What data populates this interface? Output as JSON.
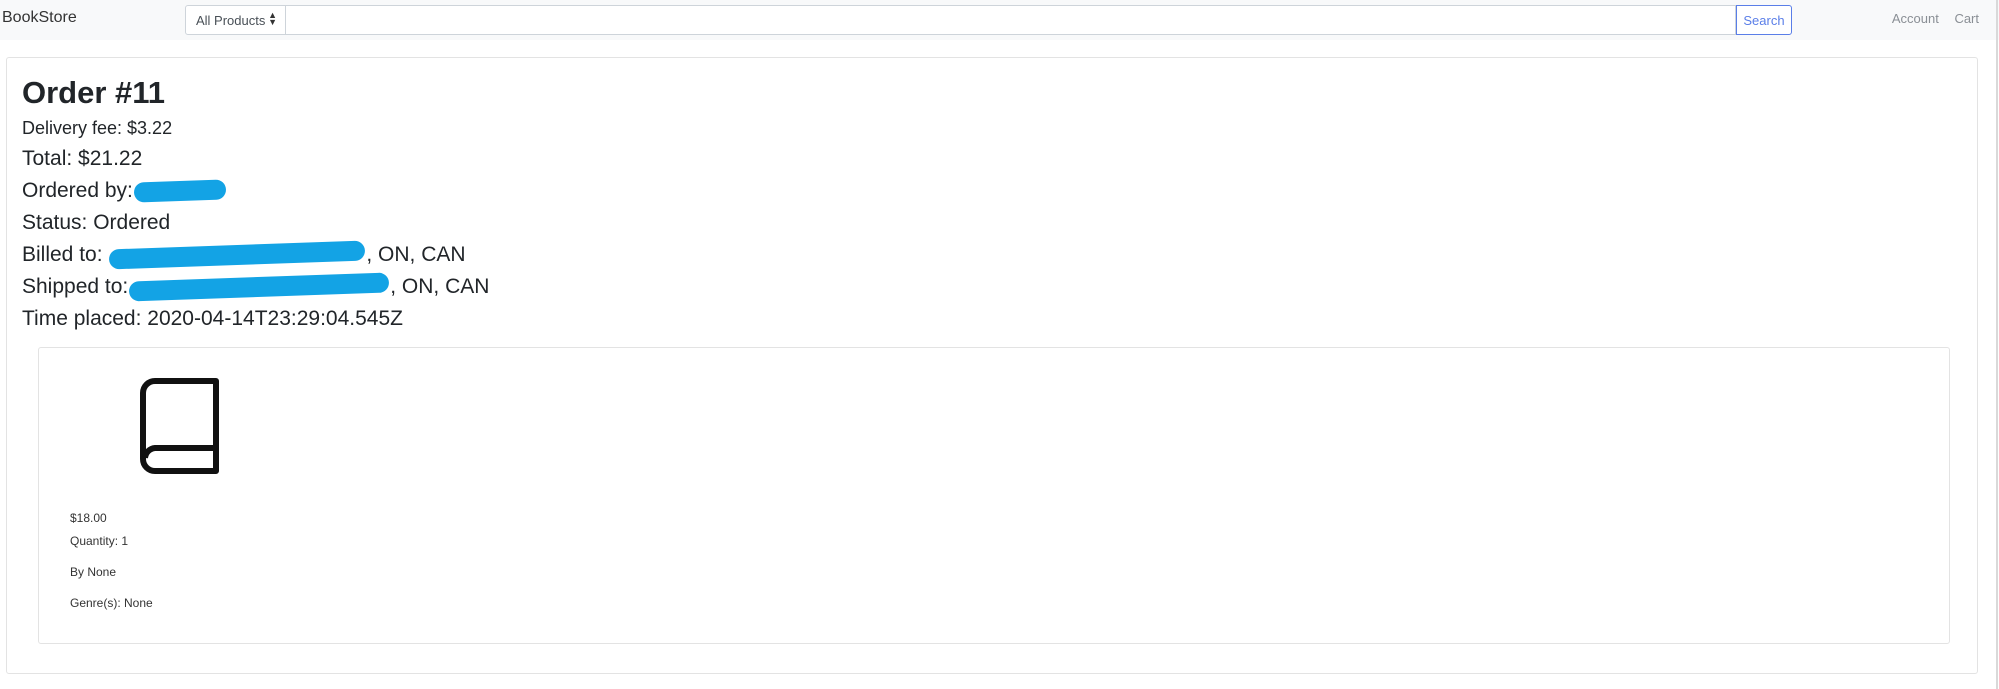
{
  "navbar": {
    "brand": "BookStore",
    "category_select": {
      "selected": "All Products"
    },
    "search": {
      "value": "",
      "placeholder": "",
      "button_label": "Search"
    },
    "links": {
      "account": "Account",
      "cart": "Cart"
    }
  },
  "order": {
    "title": "Order #11",
    "delivery_fee": "Delivery fee: $3.22",
    "total": "Total: $21.22",
    "ordered_by_label": "Ordered by:",
    "status": "Status: Ordered",
    "billed_to_label": "Billed to:",
    "billed_to_suffix": ", ON, CAN",
    "shipped_to_label": "Shipped to:",
    "shipped_to_suffix": ", ON, CAN",
    "time_placed": "Time placed: 2020-04-14T23:29:04.545Z"
  },
  "item": {
    "icon": "book-icon",
    "price": "$18.00",
    "quantity": "Quantity: 1",
    "author": "By None",
    "genres": "Genre(s): None"
  },
  "colors": {
    "navbar_bg": "#f8f9fa",
    "search_button": "#5a7ee8",
    "redaction": "#13a3e5"
  }
}
